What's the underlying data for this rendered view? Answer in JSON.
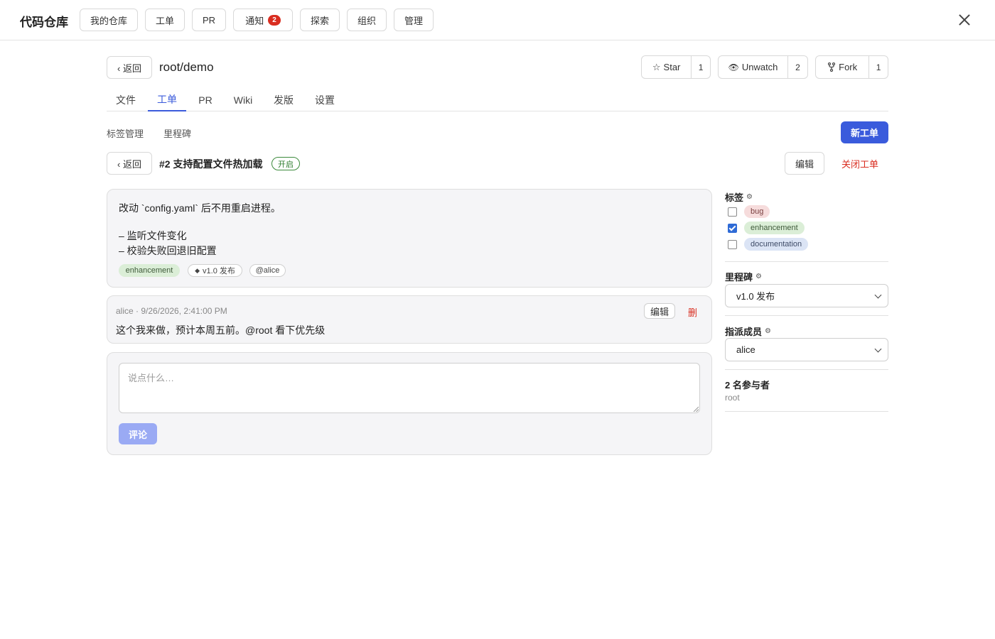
{
  "topbar": {
    "brand": "代码仓库",
    "nav": [
      {
        "label": "我的仓库"
      },
      {
        "label": "工单"
      },
      {
        "label": "PR"
      },
      {
        "label": "通知",
        "badge": "2"
      },
      {
        "label": "探索"
      },
      {
        "label": "组织"
      },
      {
        "label": "管理"
      }
    ]
  },
  "repo": {
    "back_label": "‹ 返回",
    "name": "root/demo",
    "star": {
      "label": "Star",
      "count": "1"
    },
    "watch": {
      "label": "Unwatch",
      "count": "2"
    },
    "fork": {
      "label": "Fork",
      "count": "1"
    },
    "tabs": [
      {
        "label": "文件"
      },
      {
        "label": "工单",
        "active": true
      },
      {
        "label": "PR"
      },
      {
        "label": "Wiki"
      },
      {
        "label": "发版"
      },
      {
        "label": "设置"
      }
    ]
  },
  "issues_nav": {
    "labels_link": "标签管理",
    "milestones_link": "里程碑",
    "new_issue": "新工单"
  },
  "issue": {
    "back_label": "‹ 返回",
    "title": "#2 支持配置文件热加载",
    "status": "开启",
    "edit_label": "编辑",
    "close_label": "关闭工单",
    "body_lines": [
      "改动 `config.yaml` 后不用重启进程。",
      "– 监听文件变化",
      "– 校验失败回退旧配置"
    ],
    "chips": {
      "label": "enhancement",
      "milestone": "v1.0 发布",
      "assignee": "@alice"
    }
  },
  "comment": {
    "meta": "alice · 9/26/2026, 2:41:00 PM",
    "text": "这个我来做，预计本周五前。@root 看下优先级",
    "edit_label": "编辑",
    "delete_label": "删"
  },
  "composer": {
    "placeholder": "说点什么…",
    "submit_label": "评论"
  },
  "sidebar": {
    "labels_heading": "标签",
    "labels": [
      {
        "name": "bug",
        "checked": false,
        "color": "#f6dcdc"
      },
      {
        "name": "enhancement",
        "checked": true,
        "color": "#dbeed7"
      },
      {
        "name": "documentation",
        "checked": false,
        "color": "#dbe4f5"
      }
    ],
    "milestone_heading": "里程碑",
    "milestone_value": "v1.0 发布",
    "assignee_heading": "指派成员",
    "assignee_value": "alice",
    "participants_heading": "2 名参与者",
    "participants": "root"
  }
}
